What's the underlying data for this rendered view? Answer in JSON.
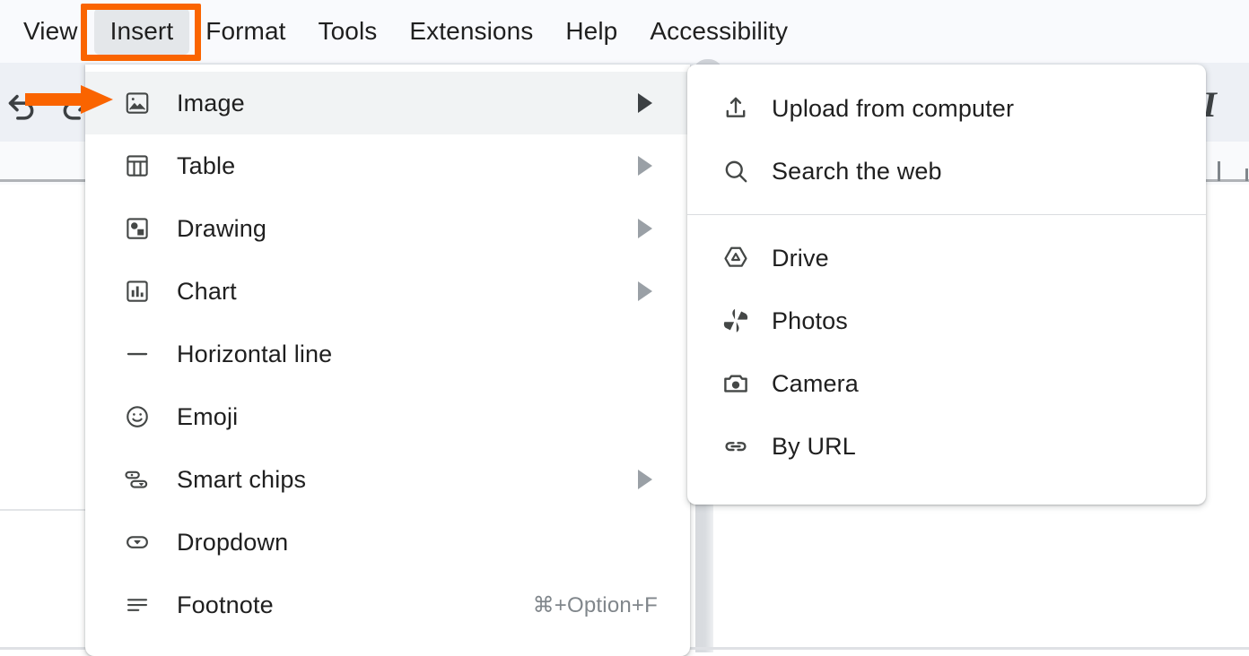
{
  "app": {
    "menubar": [
      {
        "label": "View",
        "name": "menubar-item-view",
        "active": false
      },
      {
        "label": "Insert",
        "name": "menubar-item-insert",
        "active": true
      },
      {
        "label": "Format",
        "name": "menubar-item-format",
        "active": false
      },
      {
        "label": "Tools",
        "name": "menubar-item-tools",
        "active": false
      },
      {
        "label": "Extensions",
        "name": "menubar-item-extensions",
        "active": false
      },
      {
        "label": "Help",
        "name": "menubar-item-help",
        "active": false
      },
      {
        "label": "Accessibility",
        "name": "menubar-item-accessibility",
        "active": false
      }
    ],
    "toolbar": {
      "undo_icon": "undo-icon",
      "redo_icon": "redo-icon",
      "italic_icon": "italic-icon",
      "italic_glyph": "I"
    }
  },
  "insert_menu": {
    "items": [
      {
        "label": "Horizontal line",
        "icon": "horizontal-line-icon",
        "submenu": false,
        "shortcut": "",
        "highlight": false
      },
      {
        "label": "Image",
        "icon": "image-icon",
        "submenu": true,
        "shortcut": "",
        "highlight": true
      },
      {
        "label": "Table",
        "icon": "table-icon",
        "submenu": true,
        "shortcut": "",
        "highlight": false
      },
      {
        "label": "Drawing",
        "icon": "drawing-icon",
        "submenu": true,
        "shortcut": "",
        "highlight": false
      },
      {
        "label": "Chart",
        "icon": "chart-icon",
        "submenu": true,
        "shortcut": "",
        "highlight": false
      },
      {
        "label": "Emoji",
        "icon": "emoji-icon",
        "submenu": false,
        "shortcut": "",
        "highlight": false
      },
      {
        "label": "Smart chips",
        "icon": "smart-chips-icon",
        "submenu": true,
        "shortcut": "",
        "highlight": false
      },
      {
        "label": "Dropdown",
        "icon": "dropdown-icon",
        "submenu": false,
        "shortcut": "",
        "highlight": false
      },
      {
        "label": "Footnote",
        "icon": "footnote-icon",
        "submenu": false,
        "shortcut": "⌘+Option+F",
        "highlight": false
      }
    ],
    "order": [
      "Image",
      "Table",
      "Drawing",
      "Chart",
      "Horizontal line",
      "Emoji",
      "Smart chips",
      "Dropdown",
      "Footnote"
    ]
  },
  "image_submenu": {
    "group_one": [
      {
        "label": "Upload from computer",
        "icon": "upload-icon"
      },
      {
        "label": "Search the web",
        "icon": "search-icon"
      }
    ],
    "group_two": [
      {
        "label": "Drive",
        "icon": "drive-icon"
      },
      {
        "label": "Photos",
        "icon": "photos-icon"
      },
      {
        "label": "Camera",
        "icon": "camera-icon"
      },
      {
        "label": "By URL",
        "icon": "link-icon"
      }
    ]
  },
  "annotations": {
    "highlight_color": "#fa6400",
    "box_target": "Insert",
    "arrow_target": "Image"
  }
}
